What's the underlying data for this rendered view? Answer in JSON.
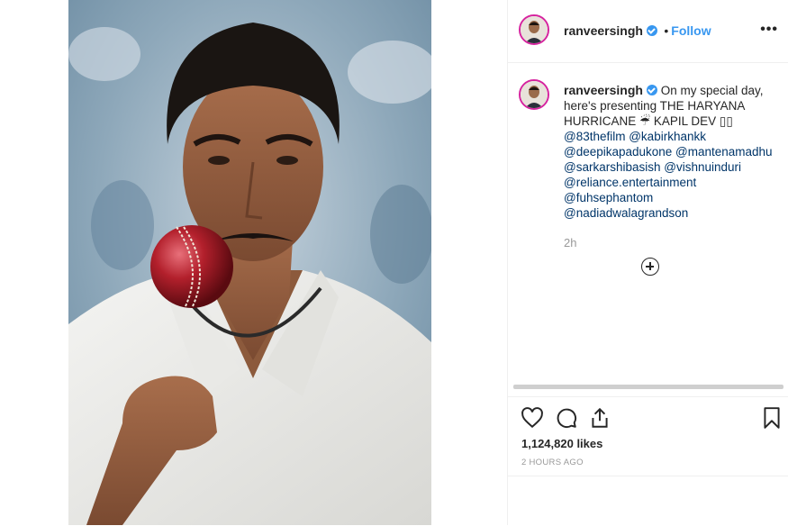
{
  "post": {
    "username": "ranveersingh",
    "follow_label": "Follow",
    "separator": "•",
    "more_label": "•••",
    "caption_text": "On my special day, here's presenting THE HARYANA HURRICANE ☔ KAPIL DEV ▯▯",
    "mentions": [
      "@83thefilm @kabirkhankk",
      "@deepikapadukone @mantenamadhu",
      "@sarkarshibasish @vishnuinduri",
      "@reliance.entertainment",
      "@fuhsephantom",
      "@nadiadwalagrandson"
    ],
    "time_ago": "2h",
    "likes": "1,124,820 likes",
    "posted": "2 HOURS AGO"
  },
  "icons": {
    "like": "heart-icon",
    "comment": "comment-icon",
    "share": "share-icon",
    "save": "bookmark-icon",
    "add": "plus-circle-icon",
    "verified": "verified-badge-icon"
  },
  "colors": {
    "link": "#003569",
    "follow": "#3897f0",
    "muted": "#999999"
  }
}
